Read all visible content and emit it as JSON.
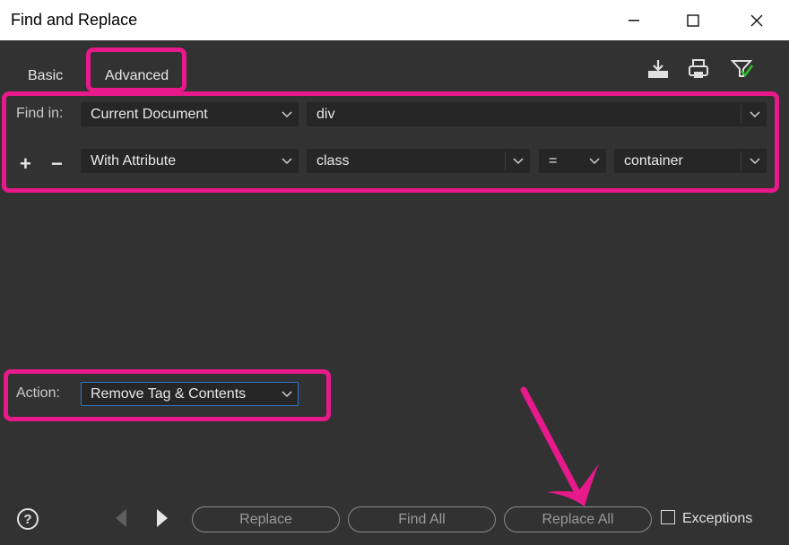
{
  "window": {
    "title": "Find and Replace"
  },
  "tabs": [
    {
      "label": "Basic"
    },
    {
      "label": "Advanced"
    }
  ],
  "toolbar": {
    "icons": [
      "save-query-icon",
      "load-query-icon",
      "find-filter-icon"
    ]
  },
  "find_in": {
    "label": "Find in:",
    "scope": "Current Document",
    "tag": "div"
  },
  "condition": {
    "add_symbol": "+",
    "remove_symbol": "−",
    "type": "With Attribute",
    "attribute": "class",
    "operator": "=",
    "value": "container"
  },
  "action": {
    "label": "Action:",
    "value": "Remove Tag & Contents"
  },
  "footer": {
    "help_symbol": "?",
    "replace_label": "Replace",
    "find_all_label": "Find All",
    "replace_all_label": "Replace All",
    "exceptions_label": "Exceptions",
    "exceptions_checked": false
  },
  "colors": {
    "highlight": "#e8198a",
    "panel_bg": "#323232",
    "field_bg": "#262626",
    "focus_border": "#2f75c9"
  }
}
